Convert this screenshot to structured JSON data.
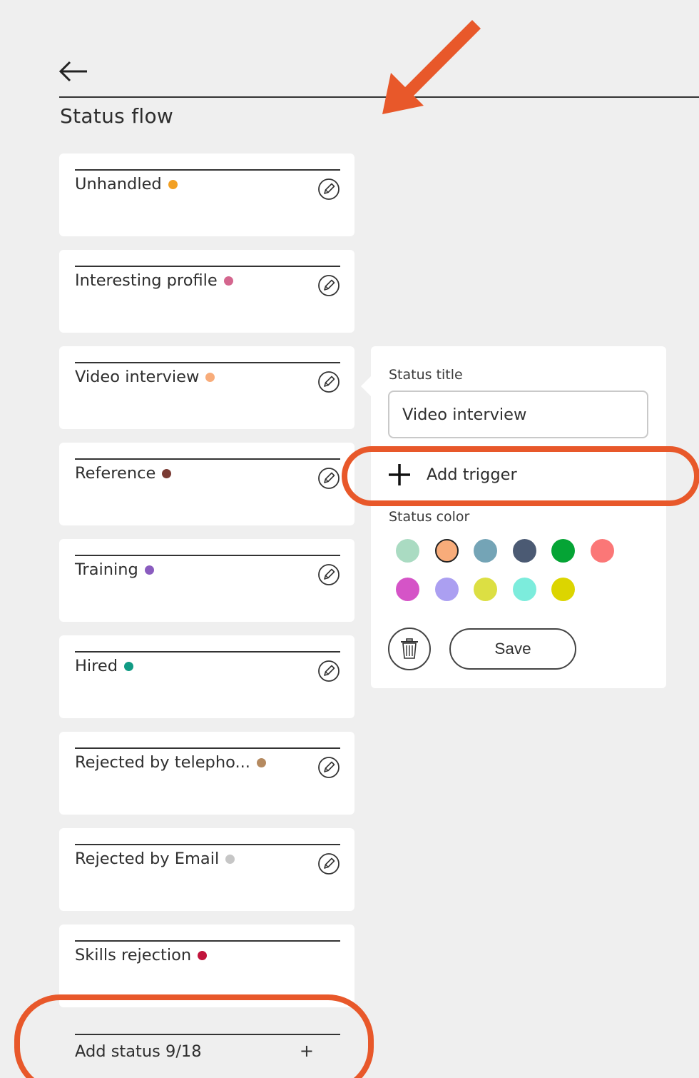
{
  "header": {
    "title": "Status flow"
  },
  "statuses": [
    {
      "label": "Unhandled",
      "color": "#f2a024"
    },
    {
      "label": "Interesting profile",
      "color": "#d4668e"
    },
    {
      "label": "Video interview",
      "color": "#f8ac7a"
    },
    {
      "label": "Reference",
      "color": "#7a3b34"
    },
    {
      "label": "Training",
      "color": "#8a5cbf"
    },
    {
      "label": "Hired",
      "color": "#119b84"
    },
    {
      "label": "Rejected by telepho...",
      "color": "#b58a60"
    },
    {
      "label": "Rejected by Email",
      "color": "#c6c6c6"
    },
    {
      "label": "Skills rejection",
      "color": "#c1143c"
    }
  ],
  "add_status": {
    "label": "Add status 9/18",
    "plus": "+"
  },
  "editor": {
    "title_label": "Status title",
    "title_value": "Video interview",
    "add_trigger_label": "Add trigger",
    "color_label": "Status color",
    "colors": [
      "#aadbc2",
      "#f8ac7a",
      "#74a4b6",
      "#4b5a73",
      "#05a435",
      "#fb7777",
      "#d554c7",
      "#ab9ff1",
      "#dcdf43",
      "#7cecdc",
      "#dcd500"
    ],
    "selected_color": "#f8ac7a",
    "save_label": "Save"
  },
  "annotation": {
    "color": "#e8582a"
  }
}
